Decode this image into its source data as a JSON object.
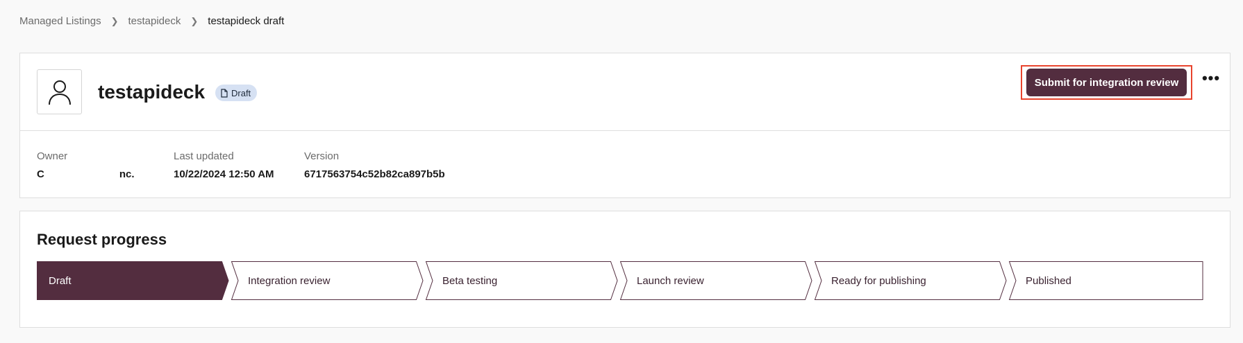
{
  "breadcrumb": {
    "items": [
      "Managed Listings",
      "testapideck",
      "testapideck draft"
    ]
  },
  "listing": {
    "name": "testapideck",
    "status_badge": "Draft",
    "submit_label": "Submit for integration review",
    "more_label": "•••"
  },
  "meta": {
    "owner_label": "Owner",
    "owner_value_start": "C",
    "owner_value_end": "nc.",
    "updated_label": "Last updated",
    "updated_value": "10/22/2024 12:50 AM",
    "version_label": "Version",
    "version_value": "6717563754c52b82ca897b5b"
  },
  "progress": {
    "title": "Request progress",
    "steps": [
      {
        "label": "Draft",
        "active": true
      },
      {
        "label": "Integration review",
        "active": false
      },
      {
        "label": "Beta testing",
        "active": false
      },
      {
        "label": "Launch review",
        "active": false
      },
      {
        "label": "Ready for publishing",
        "active": false
      },
      {
        "label": "Published",
        "active": false
      }
    ]
  },
  "colors": {
    "accent": "#532d3f",
    "highlight": "#e8432c",
    "badge_bg": "#d6e1f3"
  }
}
